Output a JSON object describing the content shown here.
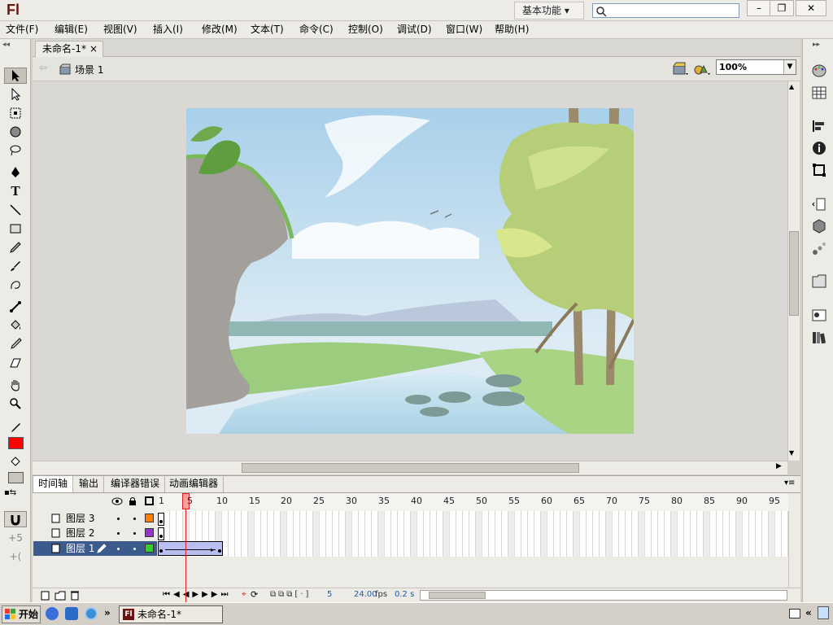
{
  "app": {
    "logo": "Fl"
  },
  "titlebar": {
    "workspace": "基本功能 ▾",
    "minimize": "–",
    "restore": "❐",
    "close": "✕"
  },
  "menu": [
    "文件(F)",
    "编辑(E)",
    "视图(V)",
    "插入(I)",
    "修改(M)",
    "文本(T)",
    "命令(C)",
    "控制(O)",
    "调试(D)",
    "窗口(W)",
    "帮助(H)"
  ],
  "document": {
    "tab": "未命名-1*",
    "tab_close": "×",
    "scene": "场景 1",
    "zoom": "100%"
  },
  "panels": {
    "tabs": [
      "时间轴",
      "输出",
      "编译器错误",
      "动画编辑器"
    ]
  },
  "timeline": {
    "ruler": [
      "1",
      "5",
      "10",
      "15",
      "20",
      "25",
      "30",
      "35",
      "40",
      "45",
      "50",
      "55",
      "60",
      "65",
      "70",
      "75",
      "80",
      "85",
      "90",
      "95"
    ],
    "playhead": "5",
    "layers": [
      {
        "name": "图层 3",
        "color": "#ff8000",
        "active": false
      },
      {
        "name": "图层 2",
        "color": "#9933cc",
        "active": false
      },
      {
        "name": "图层 1",
        "color": "#33cc33",
        "active": true
      }
    ],
    "status": {
      "frame": "5",
      "fps": "24.00",
      "fps_unit": "fps",
      "time": "0.2 s"
    }
  },
  "colors": {
    "stroke": "#000000",
    "fill": "#ff0000",
    "accent": "#3c5a8c",
    "playhead": "#e02020"
  },
  "taskbar": {
    "start": "开始",
    "chevron": "»",
    "app": "未命名-1*",
    "tray_chevron": "«"
  }
}
